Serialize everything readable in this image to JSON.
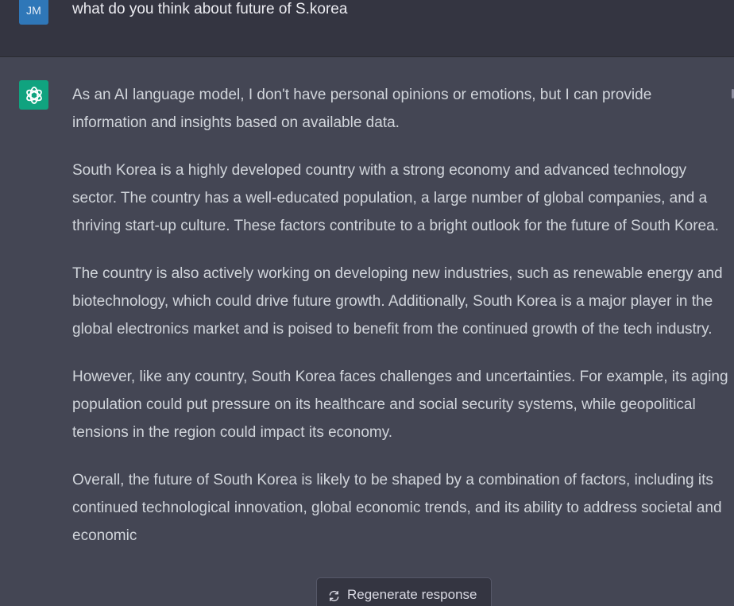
{
  "conversation": {
    "user": {
      "avatar_initials": "JM",
      "message": "what do you think about future of S.korea"
    },
    "assistant": {
      "avatar_icon": "openai-logo-icon",
      "paragraphs": [
        "As an AI language model, I don't have personal opinions or emotions, but I can provide information and insights based on available data.",
        "South Korea is a highly developed country with a strong economy and advanced technology sector. The country has a well-educated population, a large number of global companies, and a thriving start-up culture. These factors contribute to a bright outlook for the future of South Korea.",
        "The country is also actively working on developing new industries, such as renewable energy and biotechnology, which could drive future growth. Additionally, South Korea is a major player in the global electronics market and is poised to benefit from the continued growth of the tech industry.",
        "However, like any country, South Korea faces challenges and uncertainties. For example, its aging population could put pressure on its healthcare and social security systems, while geopolitical tensions in the region could impact its economy.",
        "Overall, the future of South Korea is likely to be shaped by a combination of factors, including its continued technological innovation, global economic trends, and its ability to address societal and economic"
      ]
    }
  },
  "actions": {
    "regenerate_label": "Regenerate response",
    "regenerate_icon": "refresh-icon"
  },
  "colors": {
    "user_bg": "#343541",
    "assistant_bg": "#444654",
    "assistant_avatar": "#10a37f",
    "user_avatar": "#2f77b8",
    "text": "#d1d5db"
  }
}
